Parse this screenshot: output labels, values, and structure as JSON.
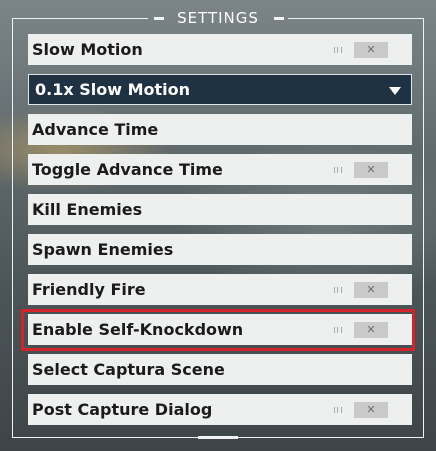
{
  "title": "SETTINGS",
  "colors": {
    "highlight": "#d4232a",
    "select_bg": "#1f3244",
    "row_bg": "#eef0f0"
  },
  "rows": [
    {
      "label": "Slow Motion",
      "toggle": true,
      "toggle_state": "off"
    },
    {
      "label": "0.1x Slow Motion",
      "type": "dropdown",
      "icon": "chevron-down-icon"
    },
    {
      "label": "Advance Time"
    },
    {
      "label": "Toggle Advance Time",
      "toggle": true,
      "toggle_state": "off"
    },
    {
      "label": "Kill Enemies"
    },
    {
      "label": "Spawn Enemies"
    },
    {
      "label": "Friendly Fire",
      "toggle": true,
      "toggle_state": "off"
    },
    {
      "label": "Enable Self-Knockdown",
      "toggle": true,
      "toggle_state": "off",
      "highlighted": true
    },
    {
      "label": "Select Captura Scene"
    },
    {
      "label": "Post Capture Dialog",
      "toggle": true,
      "toggle_state": "off"
    }
  ]
}
